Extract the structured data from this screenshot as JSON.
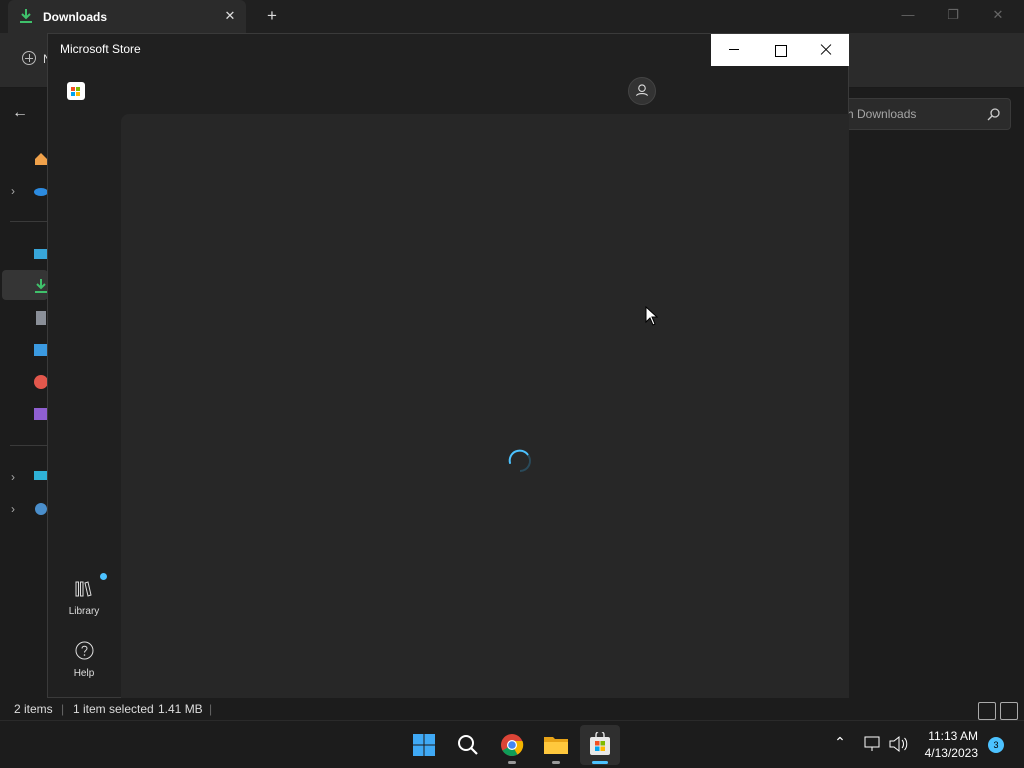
{
  "explorer": {
    "tab_title": "Downloads",
    "tab_close": "✕",
    "new_tab": "+",
    "new_label": "N",
    "search_placeholder": "h Downloads",
    "status": {
      "items": "2 items",
      "selected": "1 item selected",
      "size": "1.41 MB"
    }
  },
  "store": {
    "title": "Microsoft Store",
    "sidebar": [
      {
        "label": "Library",
        "icon": "library-icon",
        "has_badge": true
      },
      {
        "label": "Help",
        "icon": "help-icon"
      }
    ],
    "content_state": "loading"
  },
  "taskbar": {
    "apps": [
      {
        "name": "start",
        "icon": "windows-start-icon"
      },
      {
        "name": "search",
        "icon": "search-icon"
      },
      {
        "name": "chrome",
        "icon": "chrome-icon",
        "running": true
      },
      {
        "name": "file-explorer",
        "icon": "folder-icon",
        "running": true
      },
      {
        "name": "microsoft-store",
        "icon": "store-icon",
        "active": true
      }
    ],
    "clock": {
      "time": "11:13 AM",
      "date": "4/13/2023"
    },
    "notification_count": "3"
  },
  "colors": {
    "accent": "#4cc2ff",
    "explorer_bg": "#1c1c1c",
    "store_bg": "#202020",
    "store_content": "#272727"
  }
}
